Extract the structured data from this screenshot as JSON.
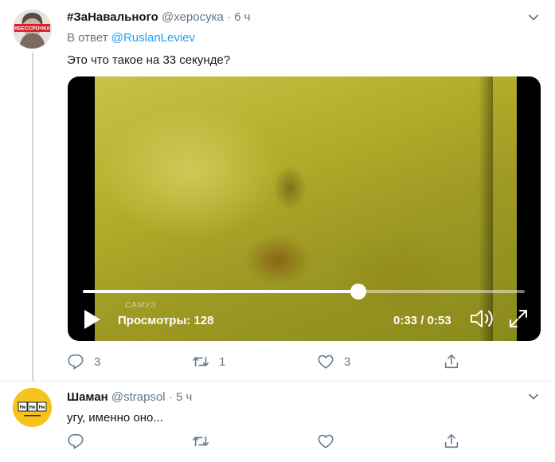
{
  "tweets": [
    {
      "display_name": "#ЗаНавального",
      "handle": "@херосука",
      "separator": "·",
      "time": "6 ч",
      "avatar_badge": "#БЕССРОЧКА",
      "reply_prefix": "В ответ",
      "reply_mention": "@RuslanLeviev",
      "text": "Это что такое на 33 секунде?",
      "video": {
        "views_label": "Просмотры: 128",
        "timecode": "0:33 / 0:53",
        "progress_fraction": 0.623,
        "watermark": "САМУЗ"
      },
      "actions": {
        "replies": "3",
        "retweets": "1",
        "likes": "3"
      }
    },
    {
      "display_name": "Шаман",
      "handle": "@strapsol",
      "separator": "·",
      "time": "5 ч",
      "avatar_tiles": [
        "Не",
        "Не",
        "Не"
      ],
      "text": "угу, именно оно...",
      "actions": {
        "replies": "",
        "retweets": "",
        "likes": ""
      }
    }
  ],
  "colors": {
    "accent": "#1da1f2",
    "secondary_text": "#657786",
    "thread_line": "#ccd6dd",
    "divider": "#e6ecf0"
  },
  "icons": {
    "caret": "chevron-down-icon",
    "reply": "reply-icon",
    "retweet": "retweet-icon",
    "like": "heart-icon",
    "share": "share-icon",
    "play": "play-icon",
    "volume": "volume-icon",
    "fullscreen": "fullscreen-icon"
  }
}
